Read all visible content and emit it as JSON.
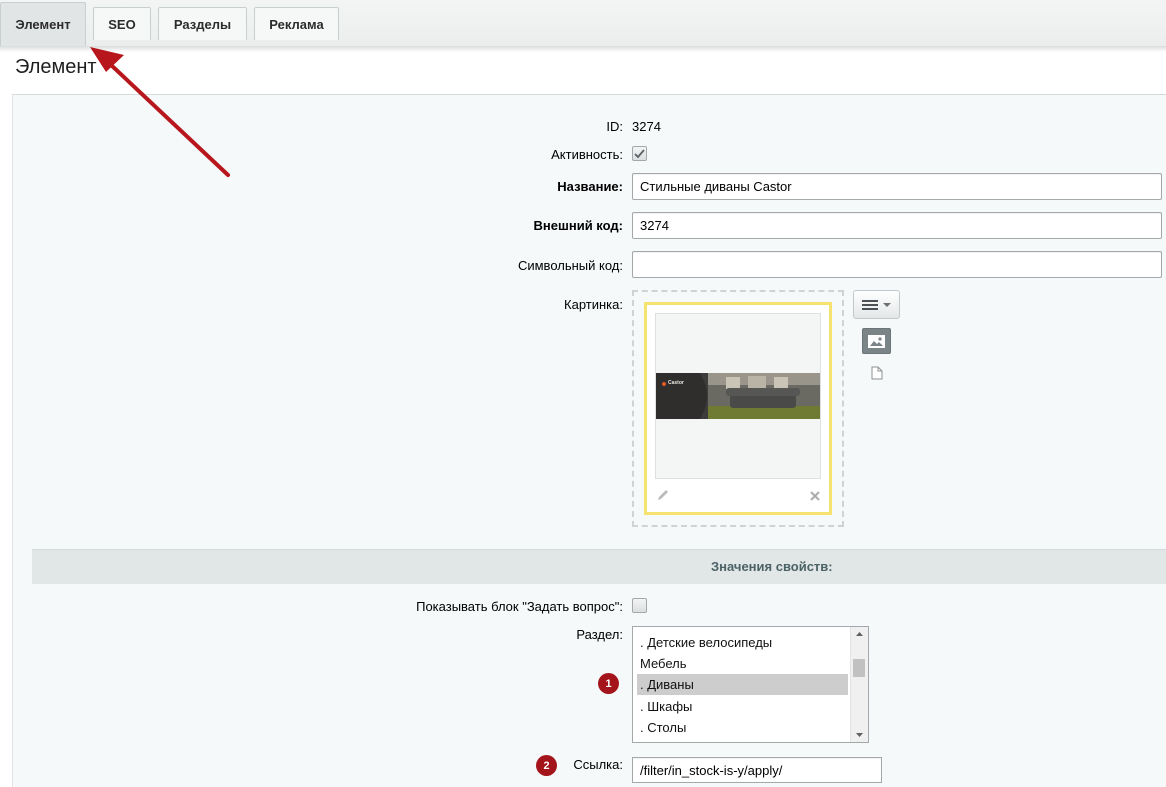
{
  "tabs": [
    {
      "label": "Элемент",
      "active": true
    },
    {
      "label": "SEO"
    },
    {
      "label": "Разделы"
    },
    {
      "label": "Реклама"
    }
  ],
  "page_title": "Элемент",
  "fields": {
    "id_label": "ID:",
    "id_value": "3274",
    "active_label": "Активность:",
    "active_checked": true,
    "name_label": "Название:",
    "name_value": "Стильные диваны Castor",
    "xml_label": "Внешний код:",
    "xml_value": "3274",
    "code_label": "Символьный код:",
    "code_value": "",
    "picture_label": "Картинка:"
  },
  "image_preview": {
    "brand_text": "Castor"
  },
  "properties": {
    "header": "Значения свойств:",
    "ask_label": "Показывать блок \"Задать вопрос\":",
    "ask_checked": false,
    "section_label": "Раздел:",
    "section_options": [
      ". Детские велосипеды",
      "Мебель",
      ". Диваны",
      ". Шкафы",
      ". Столы"
    ],
    "section_selected": ". Диваны",
    "link_label": "Ссылка:",
    "link_value": "/filter/in_stock-is-y/apply/"
  },
  "badges": [
    "1",
    "2"
  ],
  "colors": {
    "accent_arrow": "#b7161d",
    "badge": "#a3151b",
    "highlight_border": "#f5e26f"
  }
}
